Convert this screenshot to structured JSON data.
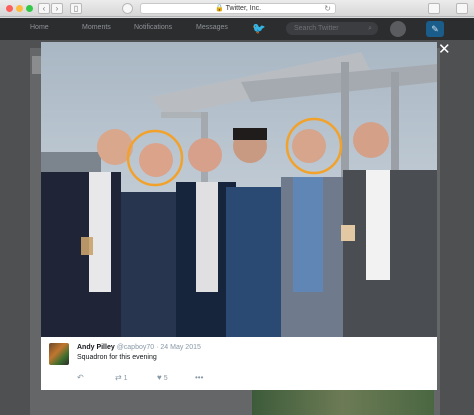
{
  "browser": {
    "url": "Twitter, Inc.",
    "back_glyph": "‹",
    "forward_glyph": "›",
    "sidebar_glyph": "▯",
    "reload_glyph": "↻",
    "lock_glyph": "🔒"
  },
  "nav": {
    "home": "Home",
    "moments": "Moments",
    "notifications": "Notifications",
    "messages": "Messages",
    "search_placeholder": "Search Twitter",
    "search_glyph": "⌕",
    "bird_glyph": "🐦",
    "tweet_glyph": "✎"
  },
  "modal": {
    "close_glyph": "✕"
  },
  "tweet": {
    "name": "Andy Pilley",
    "handle": "@capboy70",
    "separator": "·",
    "date": "24 May 2015",
    "text": "Squadron for this evening",
    "reply_glyph": "↶",
    "retweet_glyph": "⇄",
    "retweet_count": "1",
    "like_glyph": "♥",
    "like_count": "5",
    "more_glyph": "•••"
  }
}
